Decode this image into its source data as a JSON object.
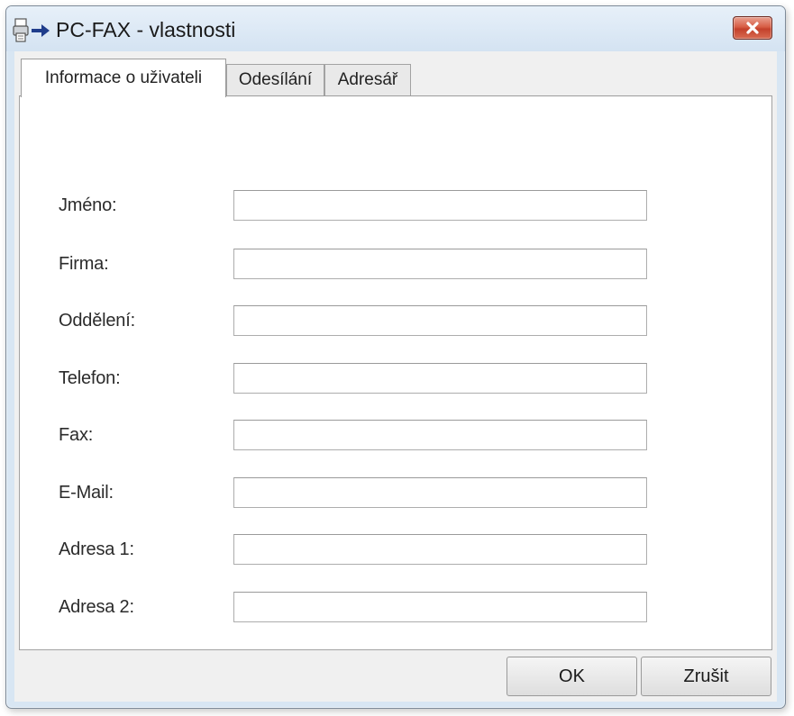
{
  "window": {
    "title": "PC-FAX - vlastnosti"
  },
  "icons": {
    "app_icon": "fax-printer-arrow-icon",
    "close_icon": "close-icon"
  },
  "tabs": [
    {
      "label": "Informace o uživateli",
      "active": true
    },
    {
      "label": "Odesílání",
      "active": false
    },
    {
      "label": "Adresář",
      "active": false
    }
  ],
  "form": {
    "fields": [
      {
        "label": "Jméno:",
        "value": ""
      },
      {
        "label": "Firma:",
        "value": ""
      },
      {
        "label": "Oddělení:",
        "value": ""
      },
      {
        "label": "Telefon:",
        "value": ""
      },
      {
        "label": "Fax:",
        "value": ""
      },
      {
        "label": "E-Mail:",
        "value": ""
      },
      {
        "label": "Adresa 1:",
        "value": ""
      },
      {
        "label": "Adresa 2:",
        "value": ""
      }
    ]
  },
  "buttons": {
    "ok_label": "OK",
    "cancel_label": "Zrušit"
  },
  "colors": {
    "title_bar": "#d8e6f3",
    "close_button": "#c94a33",
    "dialog_face": "#f0f0f0"
  }
}
